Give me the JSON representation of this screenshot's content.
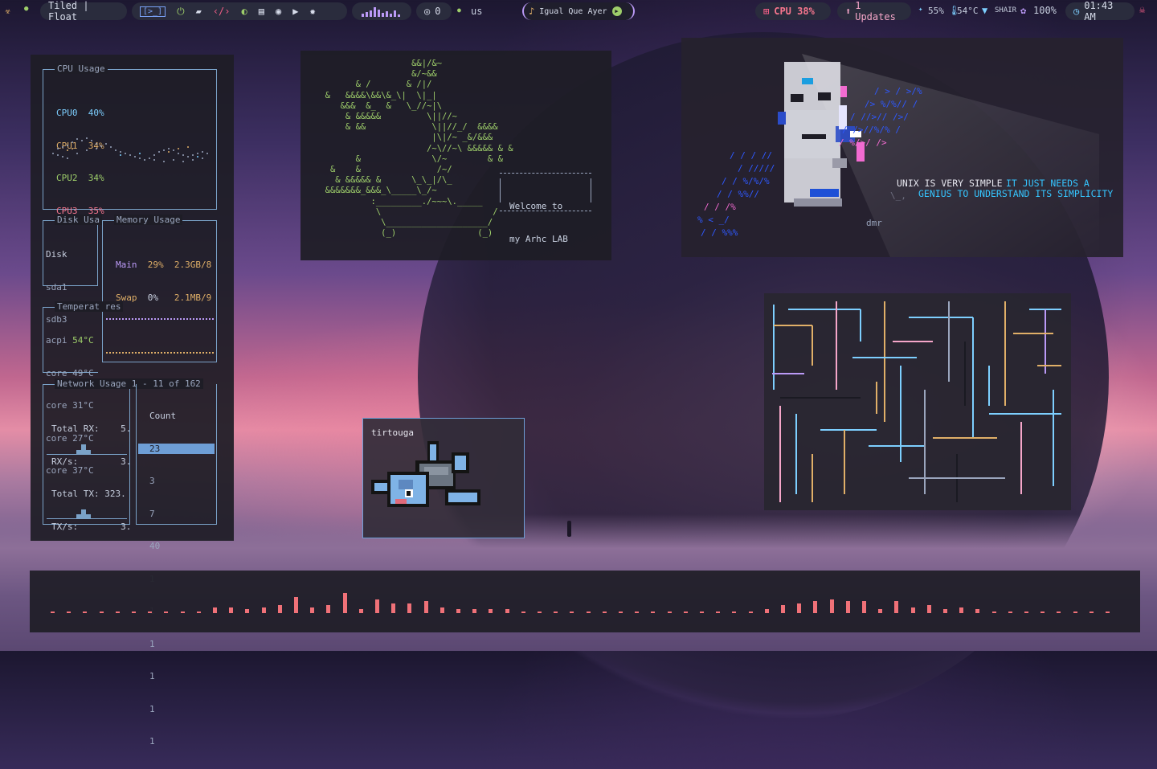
{
  "topbar": {
    "layout_mode": "Tiled | Float",
    "terminal_icon": "[>_]",
    "github_count": "0",
    "keyboard_layout": "us",
    "now_playing": "Igual Que Ayer",
    "cpu_label": "CPU 38%",
    "updates_label": "1 Updates",
    "brightness": "55%",
    "temperature": "54°C",
    "wifi": "SHAIR",
    "battery": "100%",
    "clock": "01:43 AM"
  },
  "btop": {
    "cpu": {
      "title": "CPU Usage",
      "cores": [
        {
          "name": "CPU0",
          "value": "40%",
          "color": "#7dcfff"
        },
        {
          "name": "CPU1",
          "value": "34%",
          "color": "#e0af68"
        },
        {
          "name": "CPU2",
          "value": "34%",
          "color": "#9ece6a"
        },
        {
          "name": "CPU3",
          "value": "35%",
          "color": "#f7768e"
        }
      ]
    },
    "disk": {
      "title": "Disk Usa",
      "lines": [
        "Disk",
        "sda1",
        "sdb3"
      ]
    },
    "memory": {
      "title": "Memory Usage",
      "rows": [
        {
          "name": "Main",
          "pct": "29%",
          "amount": "2.3GB/8"
        },
        {
          "name": "Swap",
          "pct": "0%",
          "amount": "2.1MB/9"
        }
      ]
    },
    "temps": {
      "title": "Temperat res",
      "rows": [
        {
          "name": "acpi",
          "value": "54°C"
        },
        {
          "name": "core",
          "value": "49°C"
        },
        {
          "name": "core",
          "value": "31°C"
        },
        {
          "name": "core",
          "value": "27°C"
        },
        {
          "name": "core",
          "value": "37°C"
        }
      ]
    },
    "network": {
      "title": "Network Usage 1 - 11 of 162",
      "total_rx": "Total RX:",
      "rx_val": "5.",
      "rx_s": "RX/s:",
      "rx_s_val": "3.",
      "total_tx": "Total TX: 323.",
      "tx_s": "TX/s:",
      "tx_s_val": "3."
    },
    "count_list": {
      "header": "Count",
      "items": [
        "23",
        "3",
        "7",
        "40",
        "1",
        "1",
        "1",
        "1",
        "1",
        "1"
      ]
    }
  },
  "art": {
    "ascii_bath": [
      "                   &&|/&~",
      "                   &/~&&",
      "        & /       & /|/",
      "  &   &&&&\\&&\\&_\\|  \\|_|",
      "     &&&  &_  &   \\_//~|\\",
      "      & &&&&&         \\||//~",
      "      & &&             \\||//_/  &&&&",
      "                       |\\|/~ _&/&&&",
      "                      /~\\//~\\ &&&&& & &",
      "        &              \\/~        & &",
      "   &    &               /~/",
      "    & &&&&& &      \\_\\_|/\\_",
      "  &&&&&&&_&&&_\\_____\\_/~",
      "           :_________./~~~\\._____",
      "            \\                      /",
      "             \\____________________/",
      "             (_)                (_)"
    ],
    "welcome_lines": [
      "Welcome to",
      "my Arhc LAB"
    ],
    "unix_quote_white": "UNIX IS VERY SIMPLE",
    "unix_quote_cyan1": "IT JUST NEEDS A",
    "unix_quote_cyan2": "GENIUS TO UNDERSTAND ITS SIMPLICITY",
    "signature": "dmr"
  },
  "pokemon": {
    "name": "tirtouga"
  }
}
